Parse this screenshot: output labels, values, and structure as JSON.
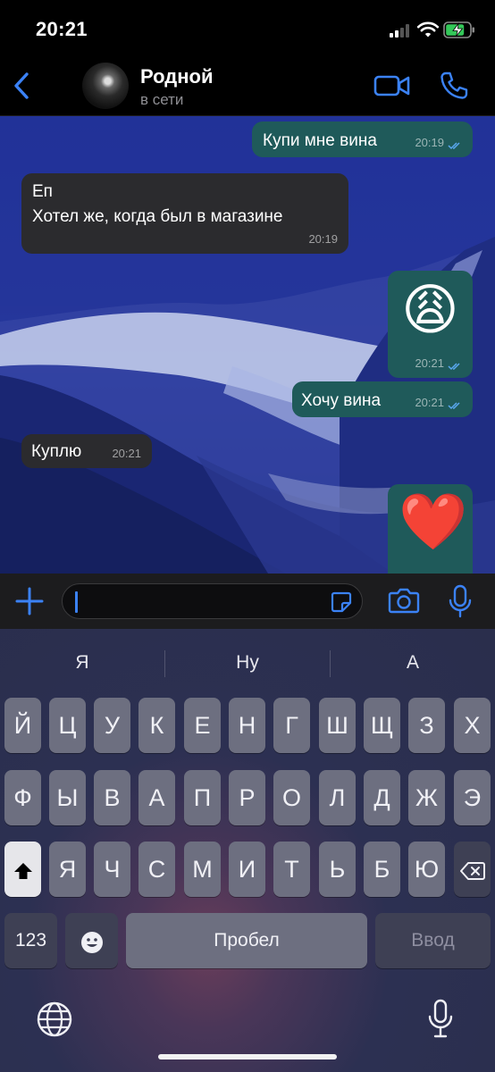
{
  "status_bar": {
    "time": "20:21"
  },
  "header": {
    "contact_name": "Родной",
    "contact_status": "в сети"
  },
  "messages": [
    {
      "direction": "out",
      "text": "Купи мне вина",
      "time": "20:19"
    },
    {
      "direction": "in",
      "text_line1": "Еп",
      "text_line2": "Хотел же, когда был в магазине",
      "time": "20:19"
    },
    {
      "direction": "out",
      "emoji": "😩",
      "time": "20:21"
    },
    {
      "direction": "out",
      "text": "Хочу вина",
      "time": "20:21"
    },
    {
      "direction": "in",
      "text": "Куплю",
      "time": "20:21"
    },
    {
      "direction": "out",
      "emoji": "❤️"
    }
  ],
  "input": {
    "placeholder": ""
  },
  "keyboard": {
    "suggestions": [
      "Я",
      "Ну",
      "А"
    ],
    "row1": [
      "Й",
      "Ц",
      "У",
      "К",
      "Е",
      "Н",
      "Г",
      "Ш",
      "Щ",
      "З",
      "Х"
    ],
    "row2": [
      "Ф",
      "Ы",
      "В",
      "А",
      "П",
      "Р",
      "О",
      "Л",
      "Д",
      "Ж",
      "Э"
    ],
    "row3": [
      "Я",
      "Ч",
      "С",
      "М",
      "И",
      "Т",
      "Ь",
      "Б",
      "Ю"
    ],
    "numbers_label": "123",
    "space_label": "Пробел",
    "return_label": "Ввод"
  },
  "colors": {
    "accent": "#3b82f6",
    "outgoing_bubble": "#1f5a5a",
    "incoming_bubble": "#2b2b2e",
    "read_ticks": "#5aa8f0"
  },
  "icons": {
    "back": "chevron-left-icon",
    "video": "video-camera-icon",
    "call": "phone-icon",
    "plus": "plus-icon",
    "sticker": "sticker-icon",
    "camera": "camera-icon",
    "mic": "microphone-icon",
    "shift": "shift-icon",
    "delete": "backspace-icon",
    "emoji": "emoji-icon",
    "globe": "globe-icon",
    "dictation": "dictation-mic-icon"
  }
}
